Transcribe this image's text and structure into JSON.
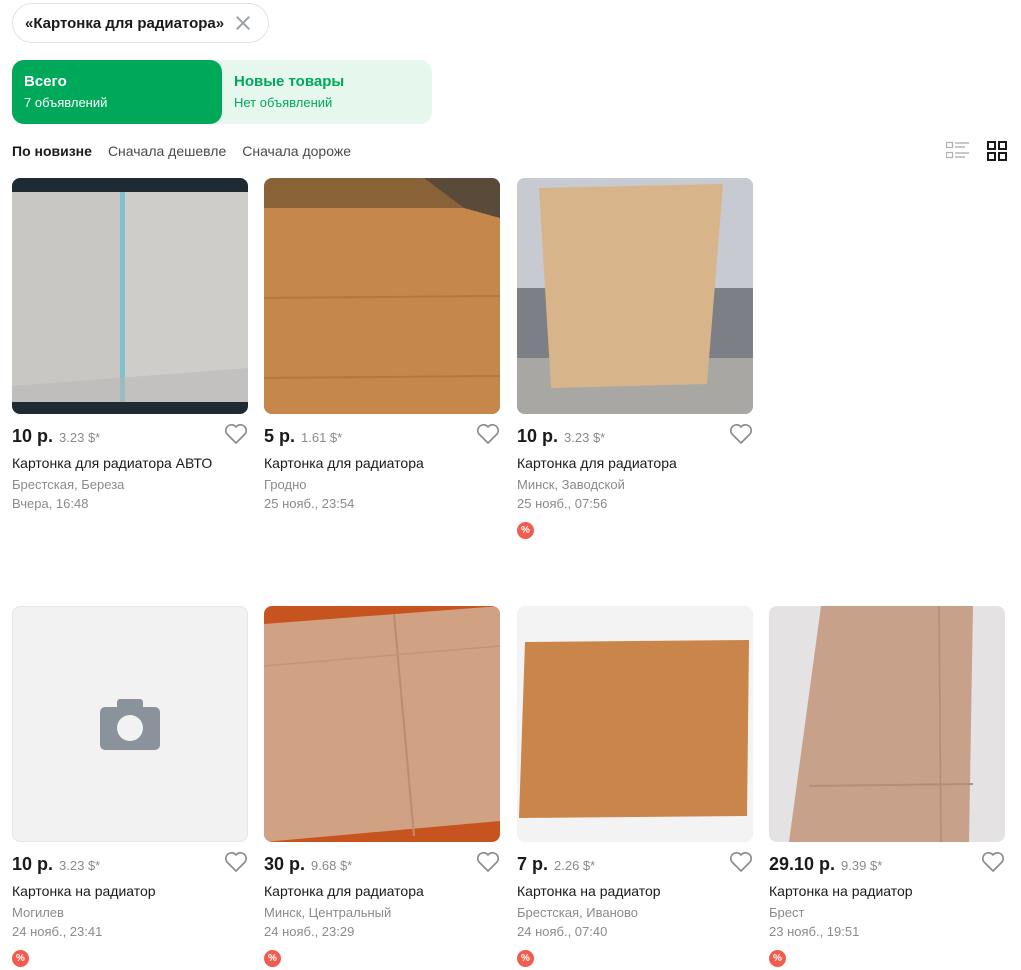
{
  "search_chip": {
    "label": "«Картонка для радиатора»",
    "close_icon": "close-icon"
  },
  "segment": {
    "all": {
      "title": "Всего",
      "subtitle": "7 объявлений"
    },
    "new": {
      "title": "Новые товары",
      "subtitle": "Нет объявлений"
    }
  },
  "sort": {
    "options": [
      "По новизне",
      "Сначала дешевле",
      "Сначала дороже"
    ],
    "selected": "По новизне"
  },
  "view": {
    "list_icon": "list-view-icon",
    "grid_icon": "grid-view-icon",
    "selected": "grid"
  },
  "colors": {
    "accent": "#00a85a",
    "accent_light": "#e6f7ee",
    "badge": "#f25c4c"
  },
  "listings": [
    {
      "price": "10 р.",
      "usd": "3.23 $*",
      "title": "Картонка для радиатора АВТО",
      "location": "Брестская, Береза",
      "date": "Вчера, 16:48",
      "badge": ""
    },
    {
      "price": "5 р.",
      "usd": "1.61 $*",
      "title": "Картонка для радиатора",
      "location": "Гродно",
      "date": "25 нояб., 23:54",
      "badge": ""
    },
    {
      "price": "10 р.",
      "usd": "3.23 $*",
      "title": "Картонка для радиатора",
      "location": "Минск, Заводской",
      "date": "25 нояб., 07:56",
      "badge": "%"
    },
    {
      "price": "10 р.",
      "usd": "3.23 $*",
      "title": "Картонка на радиатор",
      "location": "Могилев",
      "date": "24 нояб., 23:41",
      "badge": "%"
    },
    {
      "price": "30 р.",
      "usd": "9.68 $*",
      "title": "Картонка для радиатора",
      "location": "Минск, Центральный",
      "date": "24 нояб., 23:29",
      "badge": "%"
    },
    {
      "price": "7 р.",
      "usd": "2.26 $*",
      "title": "Картонка на радиатор",
      "location": "Брестская, Иваново",
      "date": "24 нояб., 07:40",
      "badge": "%"
    },
    {
      "price": "29.10 р.",
      "usd": "9.39 $*",
      "title": "Картонка на радиатор",
      "location": "Брест",
      "date": "23 нояб., 19:51",
      "badge": "%"
    }
  ]
}
